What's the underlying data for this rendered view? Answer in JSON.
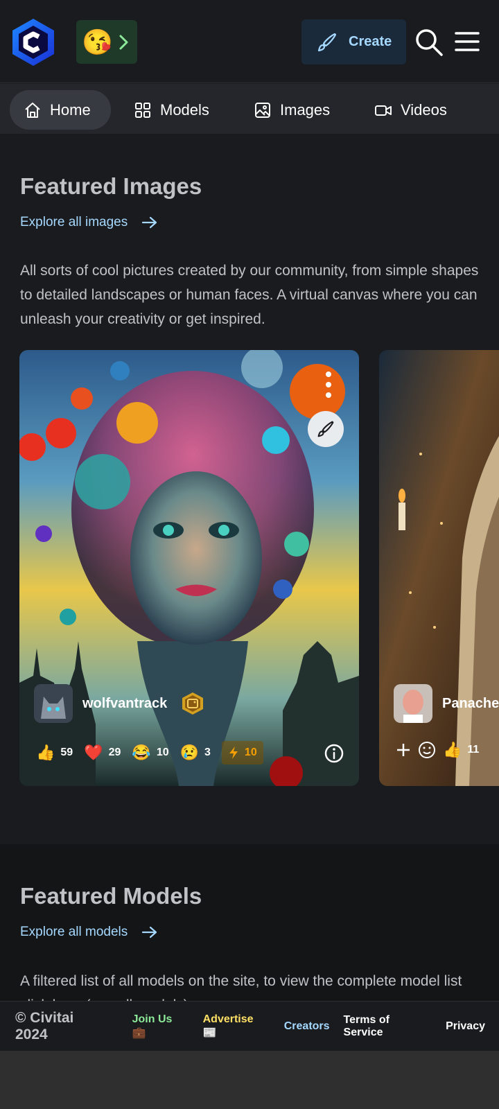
{
  "header": {
    "logo_icon": "civitai-logo-icon",
    "emoji": "😘",
    "create_label": "Create"
  },
  "nav": {
    "items": [
      {
        "label": "Home",
        "icon": "home-icon",
        "active": true
      },
      {
        "label": "Models",
        "icon": "grid-icon"
      },
      {
        "label": "Images",
        "icon": "image-icon"
      },
      {
        "label": "Videos",
        "icon": "video-icon"
      }
    ]
  },
  "featured_images": {
    "title": "Featured Images",
    "explore_label": "Explore all images",
    "description": "All sorts of cool pictures created by our community, from simple shapes to detailed landscapes or human faces. A virtual canvas where you can unleash your creativity or get inspired.",
    "cards": [
      {
        "username": "wolfvantrack",
        "reactions": [
          {
            "emoji": "👍",
            "count": "59"
          },
          {
            "emoji": "❤️",
            "count": "29"
          },
          {
            "emoji": "😂",
            "count": "10"
          },
          {
            "emoji": "😢",
            "count": "3"
          }
        ],
        "buzz": "10"
      },
      {
        "username": "Panache",
        "reactions": [
          {
            "emoji": "👍",
            "count": "11"
          }
        ]
      }
    ]
  },
  "featured_models": {
    "title": "Featured Models",
    "explore_label": "Explore all models",
    "description": "A filtered list of all models on the site, to view the complete model list click here (exp all models)."
  },
  "footer": {
    "copyright": "© Civitai 2024",
    "join": "Join Us 💼",
    "advertise": "Advertise 📰",
    "creators": "Creators",
    "terms": "Terms of Service",
    "privacy": "Privacy"
  },
  "colors": {
    "background": "#1a1b1e",
    "accent_blue": "#a5d8ff",
    "join_green": "#8ce99a",
    "advertise_yellow": "#ffe066",
    "buzz_orange": "#f59f00"
  }
}
